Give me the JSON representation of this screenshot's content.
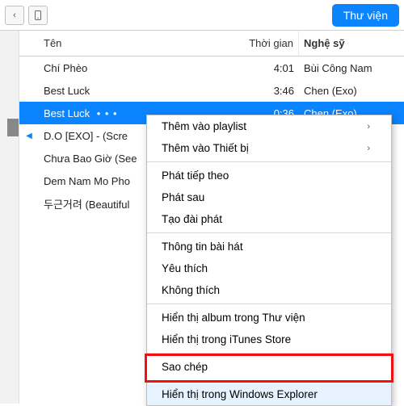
{
  "toolbar": {
    "chevron": "‹",
    "library_button": "Thư viện"
  },
  "columns": {
    "name": "Tên",
    "time": "Thời gian",
    "artist": "Nghệ sỹ"
  },
  "tracks": [
    {
      "name": "Chí Phèo",
      "time": "4:01",
      "artist": "Bùi Công Nam",
      "selected": false,
      "playing": false
    },
    {
      "name": "Best Luck",
      "time": "3:46",
      "artist": "Chen (Exo)",
      "selected": false,
      "playing": false
    },
    {
      "name": "Best Luck",
      "time": "0:36",
      "artist": "Chen (Exo)",
      "selected": true,
      "playing": false,
      "dots": "• • •"
    },
    {
      "name": "D.O [EXO] -  (Scre",
      "time": "",
      "artist": "",
      "selected": false,
      "playing": true
    },
    {
      "name": "Chưa Bao Giờ (See",
      "time": "",
      "artist": "",
      "selected": false,
      "playing": false
    },
    {
      "name": "Dem Nam Mo Pho",
      "time": "",
      "artist": "",
      "selected": false,
      "playing": false
    },
    {
      "name": "두근거려 (Beautiful",
      "time": "",
      "artist": "",
      "selected": false,
      "playing": false
    }
  ],
  "context_menu": {
    "add_playlist": "Thêm vào playlist",
    "add_device": "Thêm vào Thiết bị",
    "play_next": "Phát tiếp theo",
    "play_later": "Phát sau",
    "create_station": "Tạo đài phát",
    "song_info": "Thông tin bài hát",
    "love": "Yêu thích",
    "dislike": "Không thích",
    "show_album": "Hiển thị album trong Thư viện",
    "show_store": "Hiển thị trong iTunes Store",
    "copy": "Sao chép",
    "show_explorer": "Hiển thị trong Windows Explorer",
    "arrow": "›"
  }
}
